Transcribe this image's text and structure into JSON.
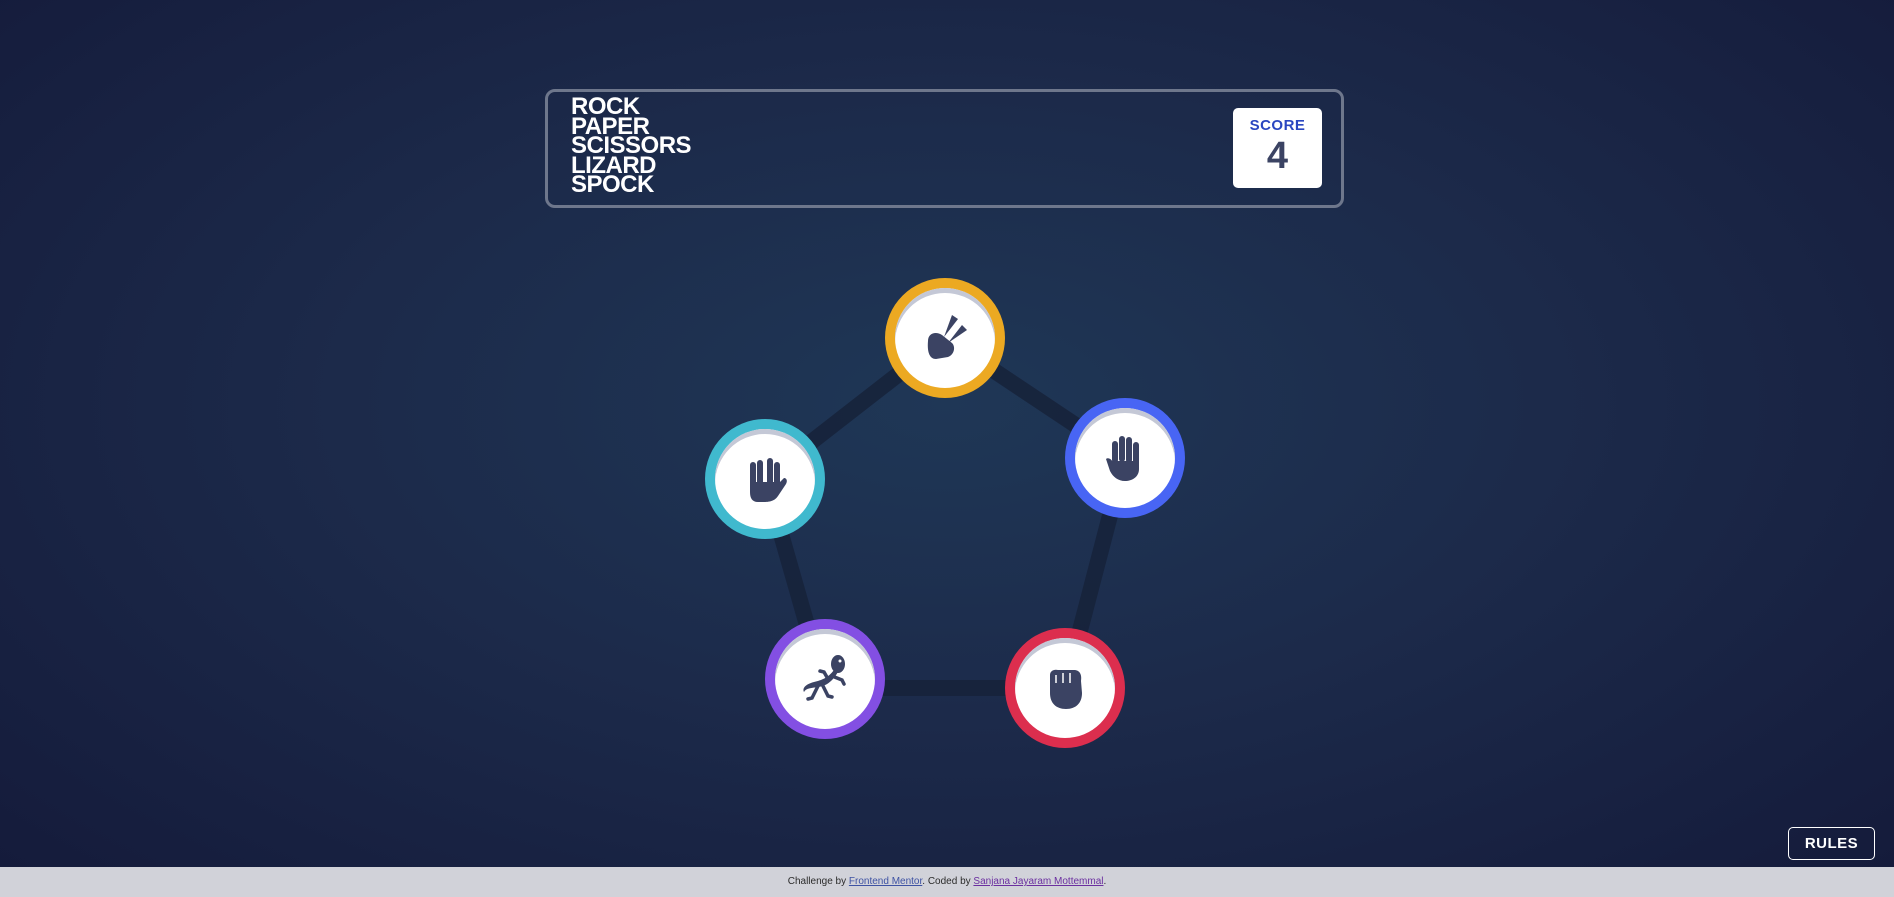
{
  "header": {
    "title_words": [
      "ROCK",
      "PAPER",
      "SCISSORS",
      "LIZARD",
      "SPOCK"
    ],
    "score_label": "SCORE",
    "score_value": "4"
  },
  "tokens": [
    {
      "name": "scissors",
      "color": "#eca922",
      "icon": "scissors-icon"
    },
    {
      "name": "paper",
      "color": "#4865f4",
      "icon": "paper-icon"
    },
    {
      "name": "rock",
      "color": "#dc2e4e",
      "icon": "rock-icon"
    },
    {
      "name": "lizard",
      "color": "#834fe3",
      "icon": "lizard-icon"
    },
    {
      "name": "spock",
      "color": "#40b9ce",
      "icon": "spock-icon"
    }
  ],
  "rules_button": "RULES",
  "attribution": {
    "prefix": "Challenge by ",
    "link1": "Frontend Mentor",
    "middle": ". Coded by ",
    "link2": "Sanjana Jayaram Mottemmal",
    "suffix": "."
  },
  "colors": {
    "background_center": "#1f3756",
    "background_edge": "#141a3a",
    "icon_dark": "#3b4363"
  }
}
